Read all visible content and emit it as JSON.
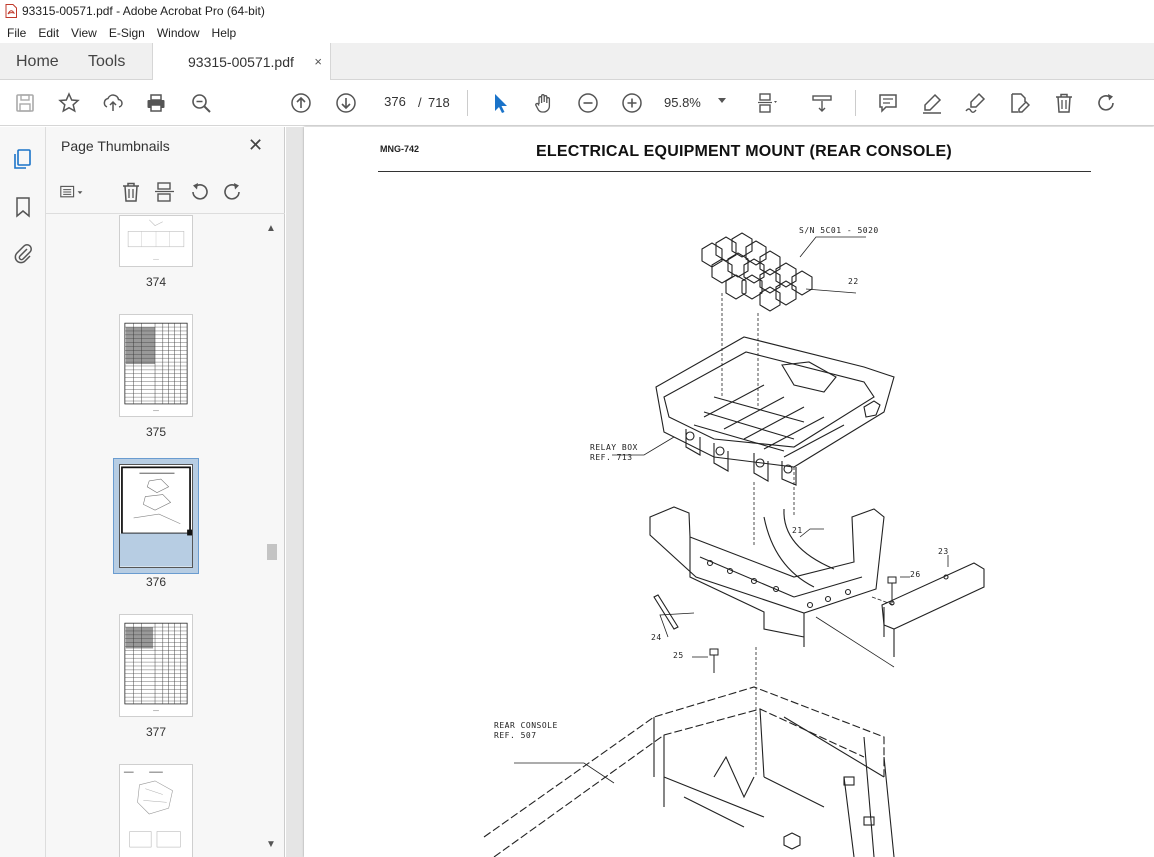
{
  "window": {
    "title": "93315-00571.pdf - Adobe Acrobat Pro (64-bit)"
  },
  "menu": [
    "File",
    "Edit",
    "View",
    "E-Sign",
    "Window",
    "Help"
  ],
  "tabs": {
    "home": "Home",
    "tools": "Tools",
    "document": "93315-00571.pdf",
    "close": "×"
  },
  "toolbar": {
    "current_page": "376",
    "separator": "/",
    "total_pages": "718",
    "zoom": "95.8%",
    "icons": [
      "save-icon",
      "star-icon",
      "upload-icon",
      "print-icon",
      "search-zoom-icon",
      "page-up-icon",
      "page-down-icon",
      "select-cursor-icon",
      "hand-icon",
      "zoom-out-icon",
      "zoom-in-icon",
      "fit-page-icon",
      "scroll-mode-icon",
      "comment-icon",
      "highlight-icon",
      "sign-icon",
      "edit-icon",
      "delete-icon",
      "redo-icon"
    ]
  },
  "sidebar": {
    "title": "Page Thumbnails",
    "close": "✕",
    "thumbnails": [
      {
        "label": "374"
      },
      {
        "label": "375"
      },
      {
        "label": "376",
        "selected": true
      },
      {
        "label": "377"
      },
      {
        "label": ""
      }
    ]
  },
  "document": {
    "code": "MNG-742",
    "title": "ELECTRICAL EQUIPMENT MOUNT (REAR CONSOLE)",
    "callouts": {
      "sn": "S/N 5C01 - 5020",
      "c22": "22",
      "relay_box": "RELAY BOX",
      "relay_ref": "REF. 713",
      "c21": "21",
      "c23": "23",
      "c26": "26",
      "c24": "24",
      "c25": "25",
      "rear_console": "REAR CONSOLE",
      "rear_ref": "REF. 507"
    }
  },
  "colors": {
    "accent": "#1a73c9",
    "tab_bg": "#f0f0f0",
    "panel_bg": "#f7f7f7",
    "selection": "#b7cde3"
  }
}
